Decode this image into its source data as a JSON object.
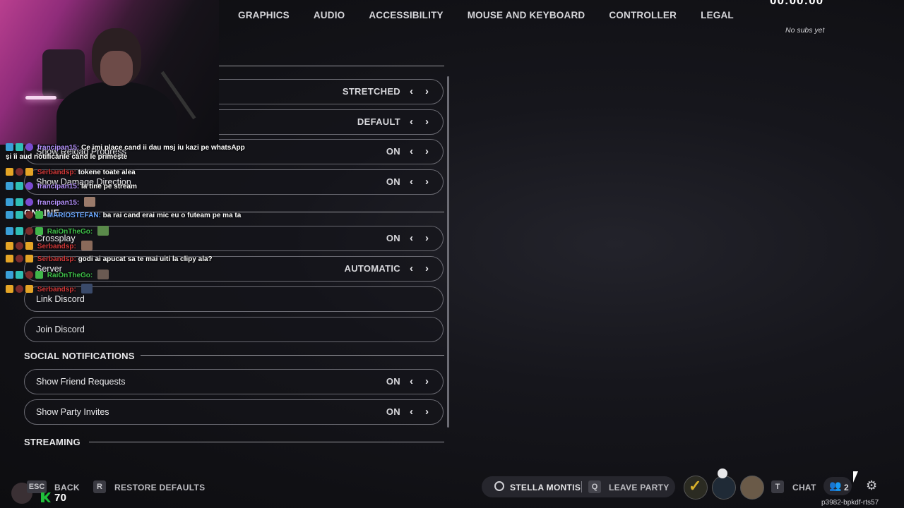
{
  "timer": "00:00:00",
  "subs_status": "No subs yet",
  "nav": {
    "tabs": [
      "GRAPHICS",
      "AUDIO",
      "ACCESSIBILITY",
      "MOUSE AND KEYBOARD",
      "CONTROLLER",
      "LEGAL"
    ]
  },
  "settings": {
    "rows": [
      {
        "label": "",
        "value": "STRETCHED"
      },
      {
        "label": "",
        "value": "DEFAULT"
      },
      {
        "label": "Show Reload Progress",
        "value": "ON"
      },
      {
        "label": "Show Damage Direction",
        "value": "ON"
      }
    ],
    "online_header": "ONLINE",
    "online_rows": [
      {
        "label": "Crossplay",
        "value": "ON"
      },
      {
        "label": "Server",
        "value": "AUTOMATIC"
      },
      {
        "label": "Link Discord",
        "value": ""
      },
      {
        "label": "Join Discord",
        "value": ""
      }
    ],
    "social_header": "SOCIAL NOTIFICATIONS",
    "social_rows": [
      {
        "label": "Show Friend Requests",
        "value": "ON"
      },
      {
        "label": "Show Party Invites",
        "value": "ON"
      }
    ],
    "streaming_header": "STREAMING"
  },
  "chat": [
    {
      "user": "francipan15:",
      "text": "Ce imi place cand ii dau msj iu kazi pe whatsApp",
      "text2": "și îi aud notificările când le primește"
    },
    {
      "user": "Serbandsp:",
      "text": "tokene toate alea"
    },
    {
      "user": "francipan15:",
      "text": "la tine pe stream"
    },
    {
      "user": "francipan15:",
      "text": ""
    },
    {
      "user": "MARIOSTEFAN:",
      "text": "ba rai cand erai mic eu o futeam pe ma ta"
    },
    {
      "user": "RaiOnTheGo:",
      "text": ""
    },
    {
      "user": "Serbandsp:",
      "text": ""
    },
    {
      "user": "Serbandsp:",
      "text": "godi ai apucat sa te mai uiti la clipy ala?"
    },
    {
      "user": "RaiOnTheGo:",
      "text": ""
    },
    {
      "user": "Serbandsp:",
      "text": ""
    }
  ],
  "bottom": {
    "back_key": "ESC",
    "back_label": "BACK",
    "restore_key": "R",
    "restore_label": "RESTORE DEFAULTS",
    "player_name": "STELLA MONTIS",
    "leave_key": "Q",
    "leave_label": "LEAVE PARTY",
    "chat_key": "T",
    "chat_label": "CHAT",
    "party_count": "2",
    "level": "70",
    "session_id": "p3982-bpkdf-rts57"
  }
}
